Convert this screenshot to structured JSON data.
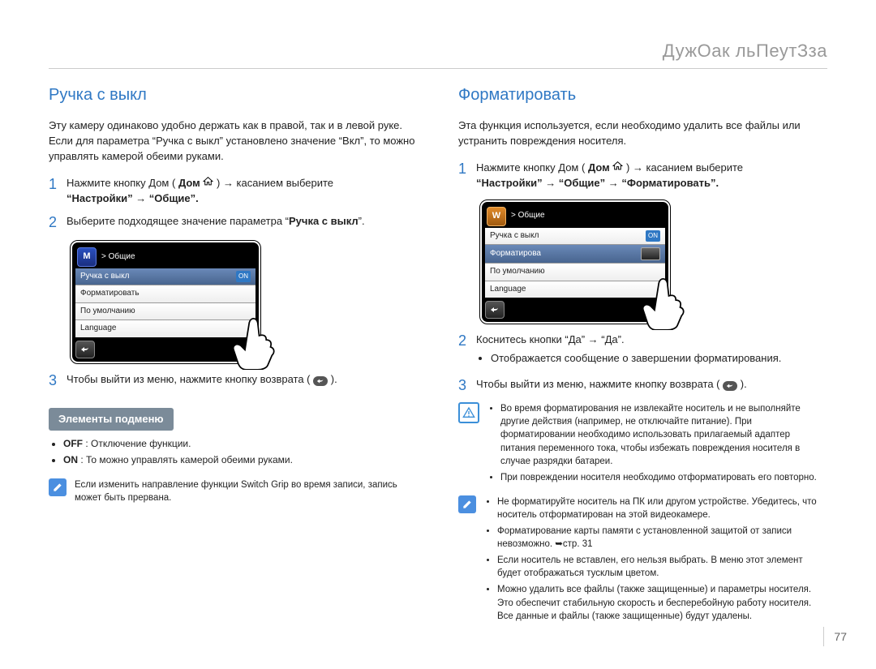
{
  "chapter": "ДужОак льПеутЗза",
  "page_number": "77",
  "left": {
    "title": "Ручка с выкл",
    "intro": "Эту камеру одинаково удобно держать как в правой, так и в левой руке. Если для параметра “Ручка с выкл” установлено значение “Вкл”, то можно управлять камерой обеими руками.",
    "step1_a": "Нажмите кнопку Дом (",
    "step1_b": ") → касанием выберите",
    "step1_path": "“Настройки” → “Общие”.",
    "step2": "Выберите подходящее значение параметра “Ручка с выкл”.",
    "step3_a": "Чтобы выйти из меню, нажмите кнопку возврата (",
    "step3_b": ").",
    "lcd": {
      "crumb": "> Общие",
      "rows": [
        "Ручка с выкл",
        "Форматировать",
        "По умолчанию",
        "Language"
      ],
      "on": "ON"
    },
    "submenu_title": "Элементы подменю",
    "submenu_off_label": "OFF",
    "submenu_off_text": " : Отключение функции.",
    "submenu_on_label": "ON",
    "submenu_on_text": " : То можно управлять камерой обеими руками.",
    "note1": "Если изменить направление функции Switch Grip во время записи, запись может быть прервана."
  },
  "right": {
    "title": "Форматировать",
    "intro": "Эта функция используется, если необходимо удалить все файлы или устранить повреждения носителя.",
    "step1_a": "Нажмите кнопку Дом (",
    "step1_b": ") → касанием выберите",
    "step1_path": "“Настройки” → “Общие” → “Форматировать”.",
    "lcd": {
      "crumb": "> Общие",
      "rows": [
        "Ручка с выкл",
        "Форматирова",
        "По умолчанию",
        "Language"
      ],
      "on": "ON"
    },
    "step2": "Коснитесь кнопки “Да” → “Да”.",
    "step2_bullet": "Отображается сообщение о завершении форматирования.",
    "step3_a": "Чтобы выйти из меню, нажмите кнопку возврата (",
    "step3_b": ").",
    "warn": [
      "Во время форматирования не извлекайте носитель и не выполняйте другие действия (например, не отключайте питание). При форматировании необходимо использовать прилагаемый адаптер питания переменного тока, чтобы избежать повреждения носителя в случае разрядки батареи.",
      "При повреждении носителя необходимо отформатировать его повторно."
    ],
    "note2": [
      "Не форматируйте носитель на ПК или другом устройстве. Убедитесь, что носитель отформатирован на этой видеокамере.",
      "Форматирование карты памяти с установленной защитой от записи невозможно. ➥стр. 31",
      "Если носитель не вставлен, его нельзя выбрать. В меню этот элемент будет отображаться тусклым цветом.",
      "Можно удалить все файлы (также защищенные) и параметры носителя. Это обеспечит стабильную скорость и бесперебойную работу носителя. Все данные и файлы (также защищенные) будут удалены."
    ]
  }
}
